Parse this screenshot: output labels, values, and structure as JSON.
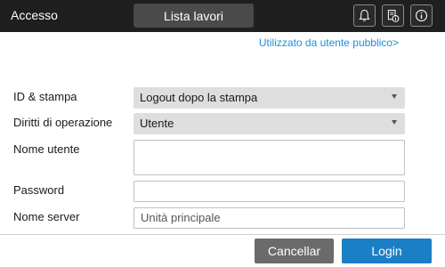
{
  "header": {
    "title": "Accesso",
    "job_list_label": "Lista lavori",
    "icons": [
      "bell-icon",
      "device-info-icon",
      "info-icon"
    ]
  },
  "public_user_link": "Utilizzato da utente pubblico>",
  "form": {
    "id_print": {
      "label": "ID & stampa",
      "value": "Logout dopo la stampa"
    },
    "operation_rights": {
      "label": "Diritti di operazione",
      "value": "Utente"
    },
    "username": {
      "label": "Nome utente",
      "value": ""
    },
    "password": {
      "label": "Password",
      "value": ""
    },
    "server_name": {
      "label": "Nome server",
      "value": "Unità principale"
    }
  },
  "actions": {
    "cancel_label": "Cancellar",
    "login_label": "Login"
  },
  "colors": {
    "header_bg": "#1f1f1f",
    "link": "#1e8fd6",
    "login_button": "#1a7fc4",
    "cancel_button": "#6b6b6b"
  }
}
